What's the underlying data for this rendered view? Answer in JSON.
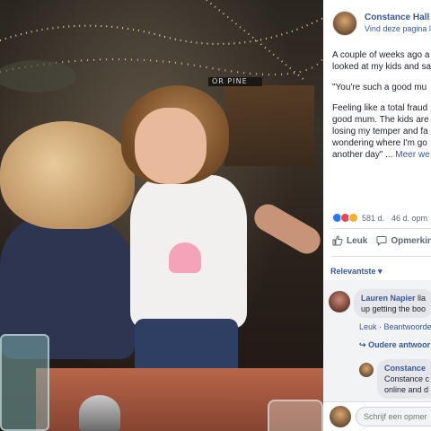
{
  "post": {
    "page_name": "Constance Hall",
    "follow_link": "Vind deze pagina l",
    "text_lines": [
      "A couple of weeks ago a",
      "looked at my kids and sa",
      "\"You're such a good mu",
      "Feeling like a total fraud",
      "good mum. The kids are",
      "losing my temper and fa",
      "wondering where I'm go",
      "another day\""
    ],
    "more_label": "Meer we",
    "reaction_count": "581 d.",
    "time_ago": "46 d. opm",
    "like_label": "Leuk",
    "comment_label": "Opmerkin",
    "sort_label": "Relevantste"
  },
  "comments": [
    {
      "author": "Lauren Napier",
      "text_suffix": "lla",
      "second_line": "up getting the boo",
      "like_label": "Leuk",
      "reply_label": "Beantwoorde",
      "replies_label": "Oudere antwoor"
    },
    {
      "author": "Constance",
      "line1": "Constance c",
      "line2": "online and d"
    }
  ],
  "composer": {
    "placeholder": "Schrijf een opmer"
  },
  "photo": {
    "sign_text": "OR   PINE"
  },
  "colors": {
    "link": "#385898",
    "like": "#2078f4",
    "love": "#f33e58",
    "haha": "#f7b125"
  }
}
